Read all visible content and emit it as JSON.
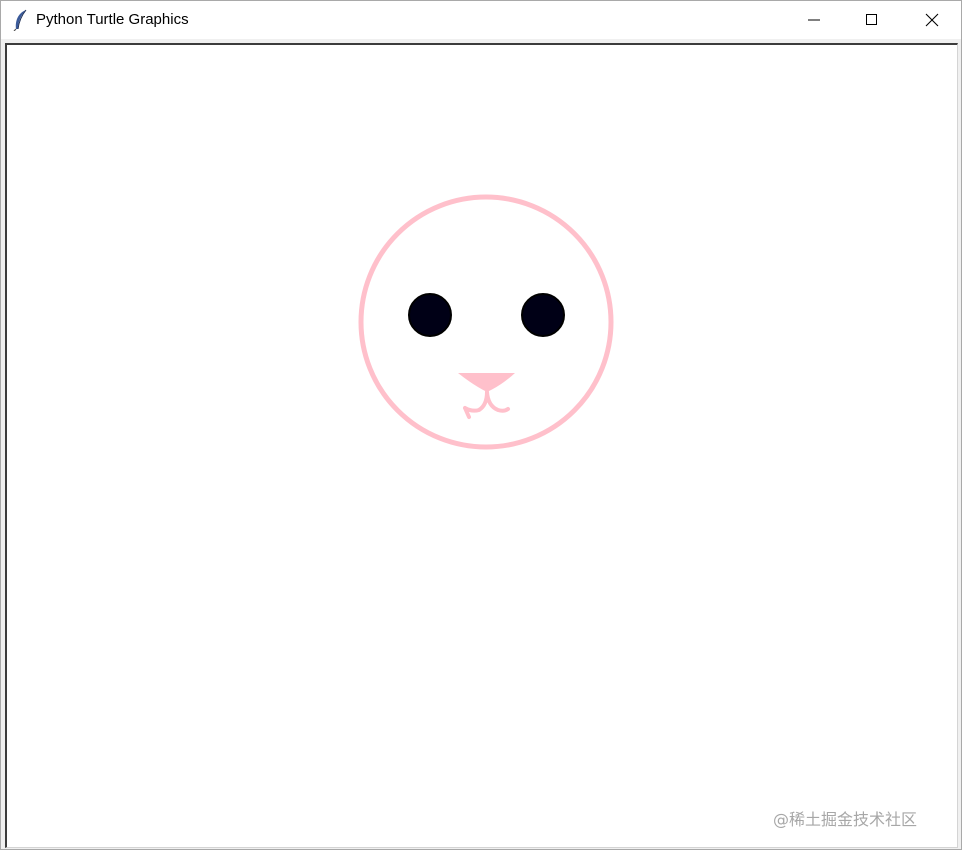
{
  "window": {
    "title": "Python Turtle Graphics",
    "app_icon": "feather-icon",
    "controls": {
      "minimize": "minimize-icon",
      "maximize": "maximize-icon",
      "close": "close-icon"
    }
  },
  "drawing": {
    "subject": "cartoon face",
    "face_color": "#ffc0cb",
    "eye_color": "#000016",
    "nose_color": "#ffc0cb",
    "mouth_color": "#ffc0cb"
  },
  "watermark": "@稀土掘金技术社区"
}
